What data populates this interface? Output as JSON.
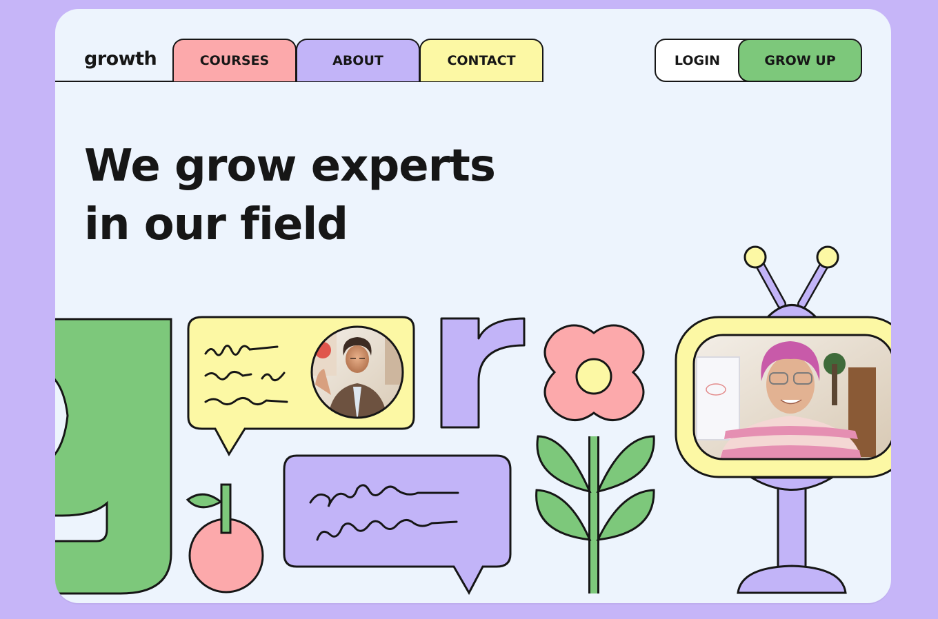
{
  "brand": {
    "logo": "growth"
  },
  "nav": {
    "tabs": [
      {
        "label": "COURSES",
        "color": "#fca9ab"
      },
      {
        "label": "ABOUT",
        "color": "#c2b4f8"
      },
      {
        "label": "CONTACT",
        "color": "#fcf8a4"
      }
    ]
  },
  "auth": {
    "login_label": "LOGIN",
    "signup_label": "GROW UP"
  },
  "hero": {
    "title_line1": "We grow experts",
    "title_line2": "in our field"
  },
  "colors": {
    "page_bg": "#c6b5f8",
    "card_bg": "#edf4fd",
    "green": "#7dc87b",
    "pink": "#fca9ab",
    "purple": "#c2b4f8",
    "yellow": "#fcf8a4",
    "ink": "#161616"
  },
  "illustration": {
    "icons": [
      "letter-g-shape",
      "chat-bubble-yellow",
      "avatar-photo-woman-waving",
      "letter-r-shape",
      "flower-icon",
      "tv-set-icon",
      "video-photo-person",
      "apple-icon",
      "chat-bubble-purple"
    ]
  }
}
